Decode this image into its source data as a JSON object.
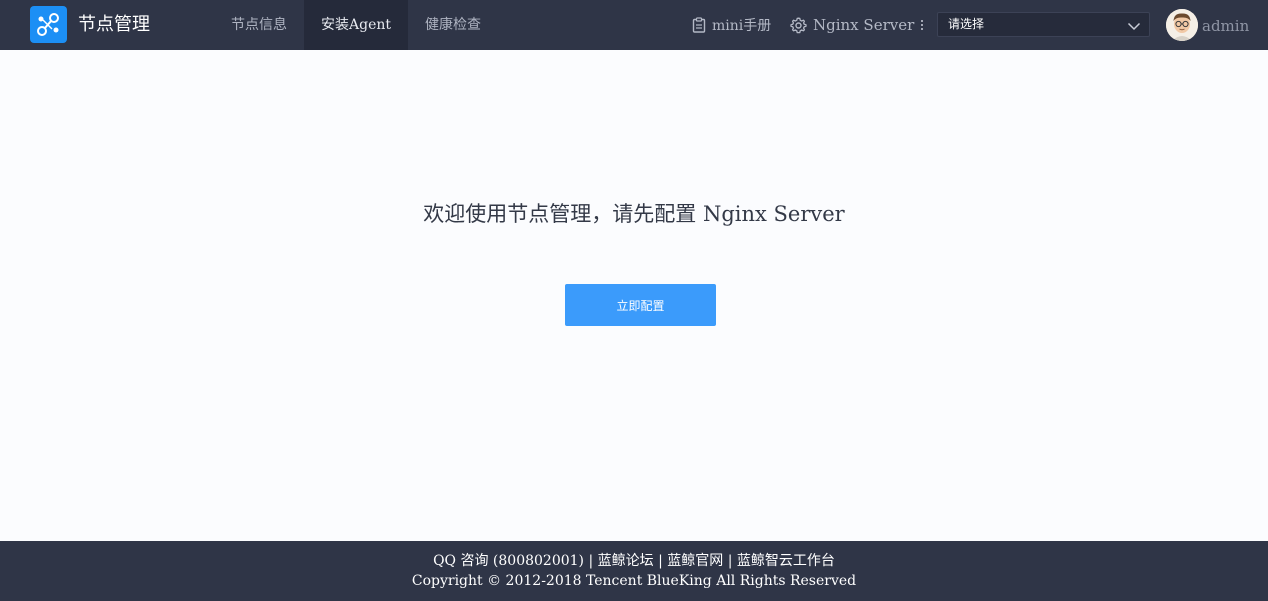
{
  "header": {
    "app_title": "节点管理",
    "tabs": [
      {
        "label": "节点信息",
        "active": false
      },
      {
        "label": "安装Agent",
        "active": true
      },
      {
        "label": "健康检查",
        "active": false
      }
    ],
    "manual_label": "mini手册",
    "nginx_label": "Nginx Server",
    "select_value": "请选择",
    "user_name": "admin",
    "colors": {
      "bar": "#2f3547",
      "logo": "#1c8ff5",
      "active_tab": "#252a3a"
    }
  },
  "main": {
    "welcome_text": "欢迎使用节点管理，请先配置 Nginx Server",
    "cta_label": "立即配置",
    "cta_color": "#3b9bfb"
  },
  "footer": {
    "links": [
      {
        "label": "QQ 咨询 (800802001)"
      },
      {
        "label": "蓝鲸论坛"
      },
      {
        "label": "蓝鲸官网"
      },
      {
        "label": "蓝鲸智云工作台"
      }
    ],
    "separator": "|",
    "copyright": "Copyright © 2012-2018 Tencent BlueKing All Rights Reserved"
  }
}
